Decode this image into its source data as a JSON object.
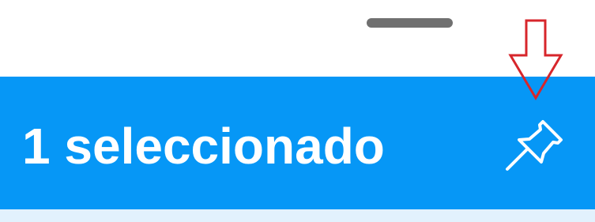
{
  "sheet": {
    "drag_handle_icon": "drag-handle"
  },
  "action_bar": {
    "title": "1 seleccionado",
    "background_color": "#0697f6",
    "pin_icon": "pushpin-icon"
  },
  "annotation": {
    "arrow_color": "#d7262b",
    "arrow_icon": "down-arrow-outline"
  },
  "list": {
    "background_color": "#e2f1fd"
  }
}
